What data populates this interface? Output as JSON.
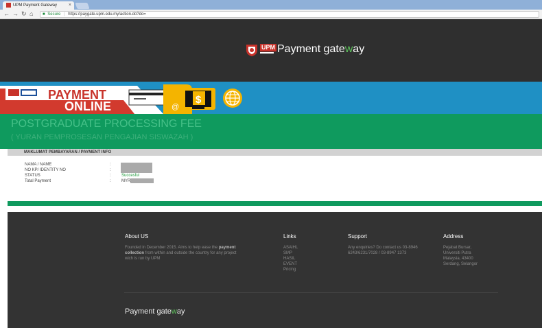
{
  "browser": {
    "tab_title": "UPM Payment Gateway",
    "tab_close": "×",
    "secure_label": "Secure",
    "url": "https://paygate.upm.edu.my/action.do?do="
  },
  "header": {
    "logo_text": "UPM",
    "brand_prefix": "Payment gate",
    "brand_highlight": "w",
    "brand_suffix": "ay"
  },
  "banner": {
    "line1": "PAYMENT",
    "line2": "ONLINE",
    "dollar": "$",
    "at": "@"
  },
  "page": {
    "title": "POSTGRADUATE PROCESSING FEE",
    "subtitle": "( YURAN PEMPROSESAN PENGAJIAN SISWAZAH )"
  },
  "info": {
    "heading": "MAKLUMAT PEMBAYARAN / PAYMENT INFO",
    "rows": [
      {
        "label": "NAMA / NAME",
        "colon": ":",
        "value": ""
      },
      {
        "label": "NO KP/ IDENTITY NO",
        "colon": ":",
        "value": ""
      },
      {
        "label": "STATUS",
        "colon": ":",
        "value": "Succesful"
      },
      {
        "label": "Total Payment",
        "colon": ":",
        "value": "MYR"
      }
    ]
  },
  "footer": {
    "about": {
      "title": "About US",
      "text_pre": "Founded in December 2015. Aims to help ease the ",
      "text_bold": "payment collection",
      "text_post": " from within and outside the country for any project wich is run by UPM"
    },
    "links": {
      "title": "Links",
      "items": [
        "ASAIHL",
        "SMP",
        "HASIL",
        "EVENT",
        "Pricing"
      ]
    },
    "support": {
      "title": "Support",
      "text": "Any enquiries? Do contact us 03-8946 6243/6231/7028 / 03-8947 1373"
    },
    "address": {
      "title": "Address",
      "lines": [
        "Pejabat Bursar,",
        "Universiti Putra",
        "Malaysia, 43400",
        "Serdang, Selangor"
      ]
    },
    "brand_prefix": "Payment gate",
    "brand_highlight": "w",
    "brand_suffix": "ay"
  },
  "colors": {
    "header_bg": "#2f2f2f",
    "banner_bg": "#1f90c4",
    "accent_green": "#0f9a5e",
    "upm_red": "#c8322a",
    "footer_bg": "#333333"
  }
}
